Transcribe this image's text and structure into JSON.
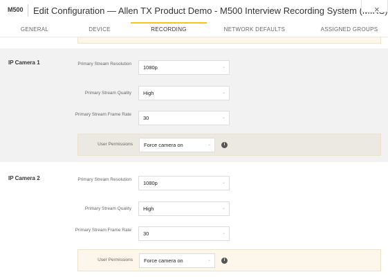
{
  "header": {
    "badge": "M500",
    "title": "Edit Configuration — Allen TX Product Demo - M500 Interview Recording System (MIRS)",
    "close": "×"
  },
  "tabs": [
    {
      "label": "GENERAL"
    },
    {
      "label": "DEVICE"
    },
    {
      "label": "RECORDING",
      "active": true
    },
    {
      "label": "NETWORK DEFAULTS"
    },
    {
      "label": "ASSIGNED GROUPS"
    }
  ],
  "cameras": [
    {
      "title": "IP Camera 1",
      "resolution_label": "Primary Stream Resolution",
      "resolution": "1080p",
      "quality_label": "Primary Stream Quality",
      "quality": "High",
      "framerate_label": "Primary Stream Frame Rate",
      "framerate": "30",
      "permissions_label": "User Permissions",
      "permissions": "Force camera on"
    },
    {
      "title": "IP Camera 2",
      "resolution_label": "Primary Stream Resolution",
      "resolution": "1080p",
      "quality_label": "Primary Stream Quality",
      "quality": "High",
      "framerate_label": "Primary Stream Frame Rate",
      "framerate": "30",
      "permissions_label": "User Permissions",
      "permissions": "Force camera on"
    }
  ],
  "icons": {
    "chevron": "⌄",
    "info": "i"
  }
}
